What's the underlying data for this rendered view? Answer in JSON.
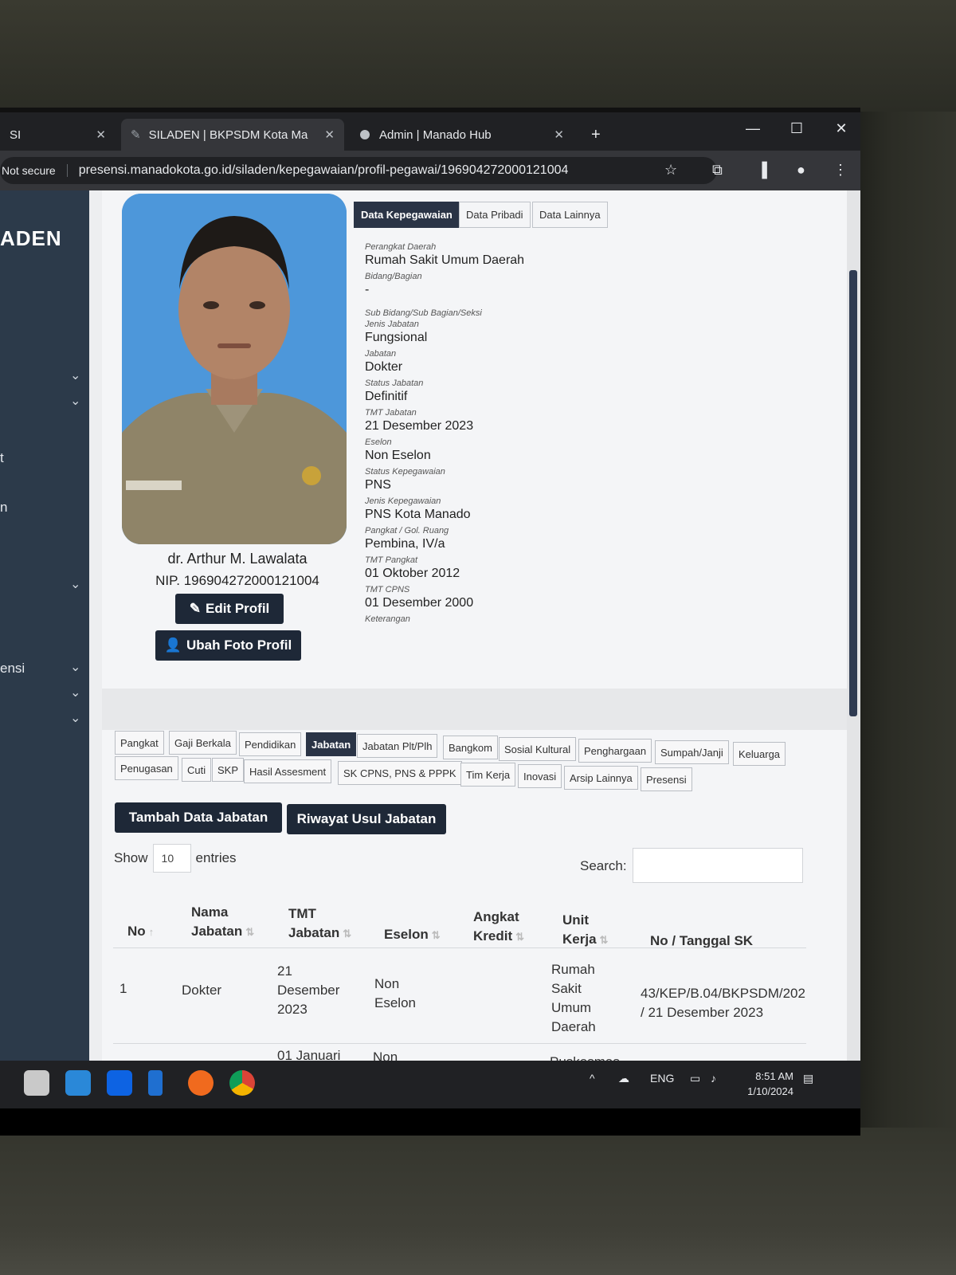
{
  "browser": {
    "tabs": [
      {
        "label": "SI",
        "close": "✕"
      },
      {
        "label": "SILADEN | BKPSDM Kota Manad",
        "close": "✕"
      },
      {
        "label": "Admin | Manado Hub",
        "close": "✕"
      }
    ],
    "new_tab": "+",
    "security": "Not secure",
    "url": "presensi.manadokota.go.id/siladen/kepegawaian/profil-pegawai/196904272000121004"
  },
  "sidebar": {
    "brand": "ADEN",
    "fragments": [
      "t",
      "n",
      "ensi"
    ]
  },
  "profile": {
    "name": "dr. Arthur M. Lawalata",
    "nip": "NIP. 196904272000121004",
    "edit_button": "Edit Profil",
    "photo_button": "Ubah Foto Profil"
  },
  "detail_tabs": [
    "Data Kepegawaian",
    "Data Pribadi",
    "Data Lainnya"
  ],
  "fields": [
    {
      "label": "Perangkat Daerah",
      "value": "Rumah Sakit Umum Daerah"
    },
    {
      "label": "Bidang/Bagian",
      "value": "-"
    },
    {
      "label": "Sub Bidang/Sub Bagian/Seksi",
      "value": ""
    },
    {
      "label": "Jenis Jabatan",
      "value": "Fungsional"
    },
    {
      "label": "Jabatan",
      "value": "Dokter"
    },
    {
      "label": "Status Jabatan",
      "value": "Definitif"
    },
    {
      "label": "TMT Jabatan",
      "value": "21 Desember 2023"
    },
    {
      "label": "Eselon",
      "value": "Non Eselon"
    },
    {
      "label": "Status Kepegawaian",
      "value": "PNS"
    },
    {
      "label": "Jenis Kepegawaian",
      "value": "PNS Kota Manado"
    },
    {
      "label": "Pangkat / Gol. Ruang",
      "value": "Pembina, IV/a"
    },
    {
      "label": "TMT Pangkat",
      "value": "01 Oktober 2012"
    },
    {
      "label": "TMT CPNS",
      "value": "01 Desember 2000"
    },
    {
      "label": "Keterangan",
      "value": ""
    }
  ],
  "record_tabs_row1": [
    "Pangkat",
    "Gaji Berkala",
    "Pendidikan",
    "Jabatan",
    "Jabatan Plt/Plh",
    "Bangkom",
    "Sosial Kultural",
    "Penghargaan",
    "Sumpah/Janji",
    "Keluarga"
  ],
  "record_tabs_row2": [
    "Penugasan",
    "Cuti",
    "SKP",
    "Hasil Assesment",
    "SK CPNS, PNS & PPPK",
    "Tim Kerja",
    "Inovasi",
    "Arsip Lainnya",
    "Presensi"
  ],
  "actions": {
    "add": "Tambah Data Jabatan",
    "history": "Riwayat Usul Jabatan"
  },
  "table_controls": {
    "show": "Show",
    "entries_value": "10",
    "entries": "entries",
    "search": "Search:"
  },
  "table": {
    "headers": [
      "No",
      "Nama Jabatan",
      "TMT Jabatan",
      "Eselon",
      "Angkat Kredit",
      "Unit Kerja",
      "No / Tanggal SK"
    ],
    "rows": [
      [
        "1",
        "Dokter",
        "21 Desember 2023",
        "Non Eselon",
        "",
        "Rumah Sakit Umum Daerah",
        "43/KEP/B.04/BKPSDM/202 / 21 Desember 2023"
      ],
      [
        "",
        "",
        "01 Januari",
        "Non",
        "",
        "Puskesmas",
        ""
      ]
    ]
  },
  "tray": {
    "lang": "ENG",
    "time": "8:51 AM",
    "date": "1/10/2024"
  }
}
